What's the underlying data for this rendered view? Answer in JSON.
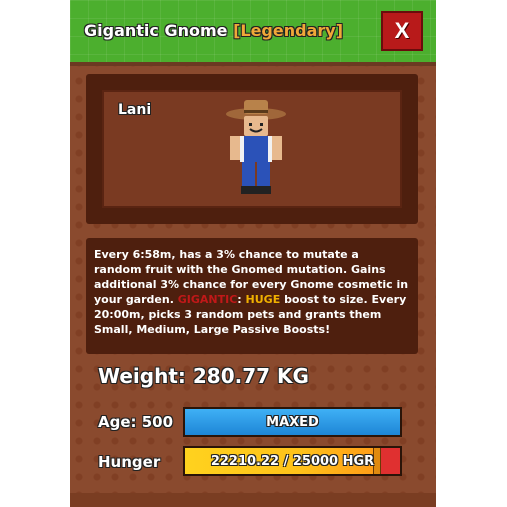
{
  "header": {
    "title": "Gigantic Gnome",
    "rarity": "[Legendary]",
    "close_label": "X"
  },
  "preview": {
    "pet_name": "Lani",
    "image": "gnome-farmer-figure"
  },
  "description": {
    "line_main": "Every 6:58m, has a 3% chance to mutate a random fruit with the Gnomed mutation. Gains additional 3% chance for every Gnome cosmetic in your garden.",
    "gigantic_tag": "GIGANTIC",
    "colon": ":",
    "huge_tag": "HUGE",
    "line_tail": "boost to size. Every 20:00m, picks 3 random pets and grants them Small, Medium, Large Passive Boosts!"
  },
  "stats": {
    "weight_label": "Weight:",
    "weight_value": "280.77 KG",
    "age_label": "Age: 500",
    "age_bar_text": "MAXED",
    "hunger_label": "Hunger",
    "hunger_text": "22210.22 / 25000 HGR",
    "hunger_current": 22210.22,
    "hunger_max": 25000
  },
  "colors": {
    "gigantic": "#c01818",
    "huge": "#f0b000",
    "rarity": "#f0a838"
  }
}
